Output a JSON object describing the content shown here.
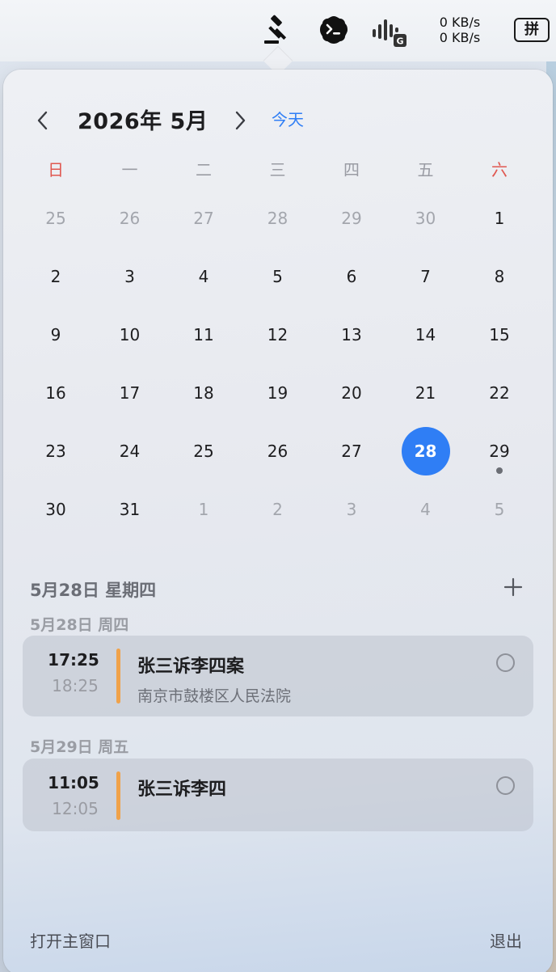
{
  "menubar": {
    "icons": [
      "gavel-icon",
      "terminal-icon",
      "audio-wave-icon"
    ],
    "net_up": "0 KB/s",
    "net_down": "0 KB/s",
    "ime_label": "拼"
  },
  "calendar": {
    "title": "2026年 5月",
    "today_label": "今天",
    "weekdays": [
      "日",
      "一",
      "二",
      "三",
      "四",
      "五",
      "六"
    ],
    "weeks": [
      [
        "25",
        "26",
        "27",
        "28",
        "29",
        "30",
        "1"
      ],
      [
        "2",
        "3",
        "4",
        "5",
        "6",
        "7",
        "8"
      ],
      [
        "9",
        "10",
        "11",
        "12",
        "13",
        "14",
        "15"
      ],
      [
        "16",
        "17",
        "18",
        "19",
        "20",
        "21",
        "22"
      ],
      [
        "23",
        "24",
        "25",
        "26",
        "27",
        "28",
        "29"
      ],
      [
        "30",
        "31",
        "1",
        "2",
        "3",
        "4",
        "5"
      ]
    ],
    "today": "28",
    "accent_color": "#2f7ef5",
    "weekend_color": "#e0574f"
  },
  "agenda": {
    "selected_date": "5月28日 星期四",
    "groups": [
      {
        "label": "5月28日 周四",
        "event": {
          "start": "17:25",
          "end": "18:25",
          "title": "张三诉李四案",
          "location": "南京市鼓楼区人民法院"
        }
      },
      {
        "label": "5月29日 周五",
        "event": {
          "start": "11:05",
          "end": "12:05",
          "title": "张三诉李四",
          "location": ""
        }
      }
    ]
  },
  "footer": {
    "open_main": "打开主窗口",
    "quit": "退出"
  }
}
